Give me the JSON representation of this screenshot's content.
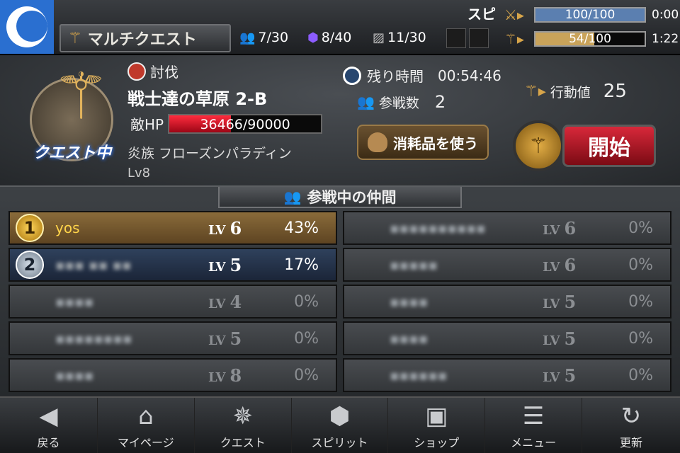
{
  "header": {
    "quest_title": "マルチクエスト",
    "stats": [
      {
        "icon": "people-icon",
        "value": "7/30"
      },
      {
        "icon": "crystal-icon",
        "value": "8/40"
      },
      {
        "icon": "card-icon",
        "value": "11/30"
      }
    ],
    "top_right_title": "スピ",
    "gauges": [
      {
        "icon": "sword-gauge-icon",
        "value": "100/100",
        "time": "0:00",
        "fill": 1.0,
        "color": "#5b7fb0"
      },
      {
        "icon": "trident-gauge-icon",
        "value": "54/100",
        "time": "1:22",
        "fill": 0.54,
        "color": "#c9a35a"
      }
    ]
  },
  "quest": {
    "status_label": "クエスト中",
    "type": "討伐",
    "stage": "戦士達の草原 2-B",
    "enemy_hp_label": "敵HP",
    "enemy_hp": "36466/90000",
    "enemy_hp_fraction": 0.405,
    "enemy_name": "炎族 フローズンパラディン",
    "enemy_level": "Lv8",
    "time_label": "残り時間",
    "time_value": "00:54:46",
    "participants_label": "参戦数",
    "participants_value": "2",
    "action_label": "行動値",
    "action_value": "25",
    "use_item_label": "消耗品を使う",
    "start_label": "開始"
  },
  "companions": {
    "title": "参戦中の仲間",
    "lv_tag": "LV",
    "left": [
      {
        "rank": "1",
        "name": "yos",
        "level": "6",
        "percent": "43%",
        "style": "gold"
      },
      {
        "rank": "2",
        "name": "▪▪▪ ▪▪ ▪▪",
        "level": "5",
        "percent": "17%",
        "style": "navy"
      },
      {
        "rank": "",
        "name": "▪▪▪▪",
        "level": "4",
        "percent": "0%",
        "style": ""
      },
      {
        "rank": "",
        "name": "▪▪▪▪▪▪▪▪",
        "level": "5",
        "percent": "0%",
        "style": ""
      },
      {
        "rank": "",
        "name": "▪▪▪▪",
        "level": "8",
        "percent": "0%",
        "style": ""
      }
    ],
    "right": [
      {
        "rank": "",
        "name": "▪▪▪▪▪▪▪▪▪▪",
        "level": "6",
        "percent": "0%",
        "style": ""
      },
      {
        "rank": "",
        "name": "▪▪▪▪▪",
        "level": "6",
        "percent": "0%",
        "style": ""
      },
      {
        "rank": "",
        "name": "▪▪▪▪",
        "level": "5",
        "percent": "0%",
        "style": ""
      },
      {
        "rank": "",
        "name": "▪▪▪▪",
        "level": "5",
        "percent": "0%",
        "style": ""
      },
      {
        "rank": "",
        "name": "▪▪▪▪▪▪",
        "level": "5",
        "percent": "0%",
        "style": ""
      }
    ]
  },
  "nav": [
    {
      "name": "back",
      "icon": "◀",
      "label": "戻る"
    },
    {
      "name": "mypage",
      "icon": "⌂",
      "label": "マイページ"
    },
    {
      "name": "quest",
      "icon": "✵",
      "label": "クエスト"
    },
    {
      "name": "split",
      "icon": "⬢",
      "label": "スピリット"
    },
    {
      "name": "shop",
      "icon": "▣",
      "label": "ショップ"
    },
    {
      "name": "menu",
      "icon": "☰",
      "label": "メニュー"
    },
    {
      "name": "refresh",
      "icon": "↻",
      "label": "更新"
    }
  ]
}
